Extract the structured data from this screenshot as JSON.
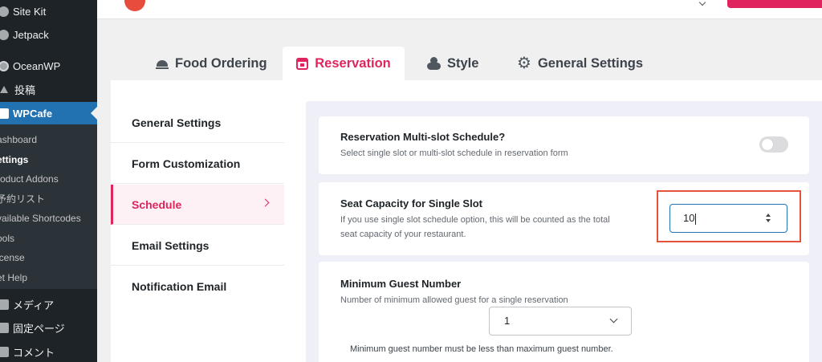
{
  "sidebar": {
    "items": [
      {
        "label": "Site Kit",
        "icon": "site-kit-icon"
      },
      {
        "label": "Jetpack",
        "icon": "jetpack-icon"
      },
      {
        "label": "OceanWP",
        "icon": "oceanwp-icon"
      },
      {
        "label": "投稿",
        "icon": "pin-icon"
      },
      {
        "label": "WPCafe",
        "icon": "wpcafe-icon"
      }
    ],
    "submenu": [
      {
        "label": "ashboard"
      },
      {
        "label": "ettings"
      },
      {
        "label": "roduct Addons"
      },
      {
        "label": "予約リスト"
      },
      {
        "label": "vailable Shortcodes"
      },
      {
        "label": "ools"
      },
      {
        "label": "icense"
      },
      {
        "label": "et Help"
      }
    ],
    "bottom_items": [
      {
        "label": "メディア",
        "icon": "media-icon"
      },
      {
        "label": "固定ページ",
        "icon": "page-icon"
      },
      {
        "label": "コメント",
        "icon": "comment-icon"
      }
    ]
  },
  "tabs": [
    {
      "label": "Food Ordering",
      "icon": "cloche-icon"
    },
    {
      "label": "Reservation",
      "icon": "calendar-icon"
    },
    {
      "label": "Style",
      "icon": "style-icon"
    },
    {
      "label": "General Settings",
      "icon": "gear-icon"
    }
  ],
  "settings_nav": [
    {
      "label": "General Settings"
    },
    {
      "label": "Form Customization"
    },
    {
      "label": "Schedule"
    },
    {
      "label": "Email Settings"
    },
    {
      "label": "Notification Email"
    }
  ],
  "cards": {
    "multi_slot": {
      "title": "Reservation Multi-slot Schedule?",
      "desc": "Select single slot or multi-slot schedule in reservation form",
      "enabled": false
    },
    "seat_capacity": {
      "title": "Seat Capacity for Single Slot",
      "desc_line1": "If you use single slot schedule option, this will be counted as the total",
      "desc_line2": "seat capacity of your restaurant.",
      "value": "10"
    },
    "min_guest": {
      "title": "Minimum Guest Number",
      "desc": "Number of minimum allowed guest for a single reservation",
      "selected": "1",
      "note": "Minimum guest number must be less than maximum guest number."
    }
  },
  "colors": {
    "accent": "#e0245e",
    "admin_sidebar": "#1d2327",
    "admin_active": "#2271b1",
    "highlight_box": "#e5533d",
    "content_bg": "#efeff8"
  }
}
